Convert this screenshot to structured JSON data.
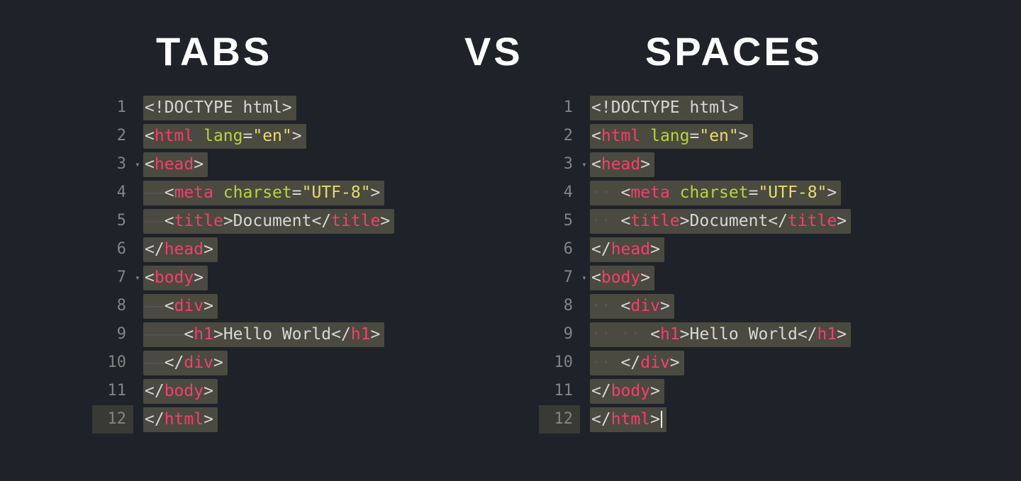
{
  "headings": {
    "tabs": "TABS",
    "vs": "VS",
    "spaces": "SPACES"
  },
  "tabs_editor": {
    "indent_style": "tabs",
    "lines": [
      {
        "n": "1",
        "fold": "",
        "indent_level": 0,
        "parts": [
          {
            "cls": "p",
            "t": "<"
          },
          {
            "cls": "doctype",
            "t": "!DOCTYPE "
          },
          {
            "cls": "doctype",
            "t": "html"
          },
          {
            "cls": "p",
            "t": ">"
          }
        ]
      },
      {
        "n": "2",
        "fold": "",
        "indent_level": 0,
        "parts": [
          {
            "cls": "p",
            "t": "<"
          },
          {
            "cls": "tg",
            "t": "html"
          },
          {
            "cls": "p",
            "t": " "
          },
          {
            "cls": "at",
            "t": "lang"
          },
          {
            "cls": "eq",
            "t": "="
          },
          {
            "cls": "str",
            "t": "\"en\""
          },
          {
            "cls": "p",
            "t": ">"
          }
        ]
      },
      {
        "n": "3",
        "fold": "▾",
        "indent_level": 0,
        "parts": [
          {
            "cls": "p",
            "t": "<"
          },
          {
            "cls": "tg",
            "t": "head"
          },
          {
            "cls": "p",
            "t": ">"
          }
        ]
      },
      {
        "n": "4",
        "fold": "",
        "indent_level": 1,
        "parts": [
          {
            "cls": "p",
            "t": "<"
          },
          {
            "cls": "tg",
            "t": "meta"
          },
          {
            "cls": "p",
            "t": " "
          },
          {
            "cls": "at",
            "t": "charset"
          },
          {
            "cls": "eq",
            "t": "="
          },
          {
            "cls": "str",
            "t": "\"UTF-8\""
          },
          {
            "cls": "p",
            "t": ">"
          }
        ]
      },
      {
        "n": "5",
        "fold": "",
        "indent_level": 1,
        "parts": [
          {
            "cls": "p",
            "t": "<"
          },
          {
            "cls": "tg",
            "t": "title"
          },
          {
            "cls": "p",
            "t": ">"
          },
          {
            "cls": "txt",
            "t": "Document"
          },
          {
            "cls": "p",
            "t": "</"
          },
          {
            "cls": "tg",
            "t": "title"
          },
          {
            "cls": "p",
            "t": ">"
          }
        ]
      },
      {
        "n": "6",
        "fold": "",
        "indent_level": 0,
        "parts": [
          {
            "cls": "p",
            "t": "</"
          },
          {
            "cls": "tg",
            "t": "head"
          },
          {
            "cls": "p",
            "t": ">"
          }
        ]
      },
      {
        "n": "7",
        "fold": "▾",
        "indent_level": 0,
        "parts": [
          {
            "cls": "p",
            "t": "<"
          },
          {
            "cls": "tg",
            "t": "body"
          },
          {
            "cls": "p",
            "t": ">"
          }
        ]
      },
      {
        "n": "8",
        "fold": "",
        "indent_level": 1,
        "parts": [
          {
            "cls": "p",
            "t": "<"
          },
          {
            "cls": "tg",
            "t": "div"
          },
          {
            "cls": "p",
            "t": ">"
          }
        ]
      },
      {
        "n": "9",
        "fold": "",
        "indent_level": 2,
        "parts": [
          {
            "cls": "p",
            "t": "<"
          },
          {
            "cls": "tg",
            "t": "h1"
          },
          {
            "cls": "p",
            "t": ">"
          },
          {
            "cls": "txt",
            "t": "Hello World"
          },
          {
            "cls": "p",
            "t": "</"
          },
          {
            "cls": "tg",
            "t": "h1"
          },
          {
            "cls": "p",
            "t": ">"
          }
        ]
      },
      {
        "n": "10",
        "fold": "",
        "indent_level": 1,
        "parts": [
          {
            "cls": "p",
            "t": "</"
          },
          {
            "cls": "tg",
            "t": "div"
          },
          {
            "cls": "p",
            "t": ">"
          }
        ]
      },
      {
        "n": "11",
        "fold": "",
        "indent_level": 0,
        "parts": [
          {
            "cls": "p",
            "t": "</"
          },
          {
            "cls": "tg",
            "t": "body"
          },
          {
            "cls": "p",
            "t": ">"
          }
        ]
      },
      {
        "n": "12",
        "fold": "",
        "indent_level": 0,
        "cursor": false,
        "parts": [
          {
            "cls": "p",
            "t": "</"
          },
          {
            "cls": "tg",
            "t": "html"
          },
          {
            "cls": "p",
            "t": ">"
          }
        ]
      }
    ],
    "indent_glyph_per_level": "——"
  },
  "spaces_editor": {
    "indent_style": "spaces",
    "lines": [
      {
        "n": "1",
        "fold": "",
        "indent_level": 0,
        "parts": [
          {
            "cls": "p",
            "t": "<"
          },
          {
            "cls": "doctype",
            "t": "!DOCTYPE "
          },
          {
            "cls": "doctype",
            "t": "html"
          },
          {
            "cls": "p",
            "t": ">"
          }
        ]
      },
      {
        "n": "2",
        "fold": "",
        "indent_level": 0,
        "parts": [
          {
            "cls": "p",
            "t": "<"
          },
          {
            "cls": "tg",
            "t": "html"
          },
          {
            "cls": "p",
            "t": " "
          },
          {
            "cls": "at",
            "t": "lang"
          },
          {
            "cls": "eq",
            "t": "="
          },
          {
            "cls": "str",
            "t": "\"en\""
          },
          {
            "cls": "p",
            "t": ">"
          }
        ]
      },
      {
        "n": "3",
        "fold": "▾",
        "indent_level": 0,
        "parts": [
          {
            "cls": "p",
            "t": "<"
          },
          {
            "cls": "tg",
            "t": "head"
          },
          {
            "cls": "p",
            "t": ">"
          }
        ]
      },
      {
        "n": "4",
        "fold": "",
        "indent_level": 1,
        "parts": [
          {
            "cls": "p",
            "t": "<"
          },
          {
            "cls": "tg",
            "t": "meta"
          },
          {
            "cls": "p",
            "t": " "
          },
          {
            "cls": "at",
            "t": "charset"
          },
          {
            "cls": "eq",
            "t": "="
          },
          {
            "cls": "str",
            "t": "\"UTF-8\""
          },
          {
            "cls": "p",
            "t": ">"
          }
        ]
      },
      {
        "n": "5",
        "fold": "",
        "indent_level": 1,
        "parts": [
          {
            "cls": "p",
            "t": "<"
          },
          {
            "cls": "tg",
            "t": "title"
          },
          {
            "cls": "p",
            "t": ">"
          },
          {
            "cls": "txt",
            "t": "Document"
          },
          {
            "cls": "p",
            "t": "</"
          },
          {
            "cls": "tg",
            "t": "title"
          },
          {
            "cls": "p",
            "t": ">"
          }
        ]
      },
      {
        "n": "6",
        "fold": "",
        "indent_level": 0,
        "parts": [
          {
            "cls": "p",
            "t": "</"
          },
          {
            "cls": "tg",
            "t": "head"
          },
          {
            "cls": "p",
            "t": ">"
          }
        ]
      },
      {
        "n": "7",
        "fold": "▾",
        "indent_level": 0,
        "parts": [
          {
            "cls": "p",
            "t": "<"
          },
          {
            "cls": "tg",
            "t": "body"
          },
          {
            "cls": "p",
            "t": ">"
          }
        ]
      },
      {
        "n": "8",
        "fold": "",
        "indent_level": 1,
        "parts": [
          {
            "cls": "p",
            "t": "<"
          },
          {
            "cls": "tg",
            "t": "div"
          },
          {
            "cls": "p",
            "t": ">"
          }
        ]
      },
      {
        "n": "9",
        "fold": "",
        "indent_level": 2,
        "parts": [
          {
            "cls": "p",
            "t": "<"
          },
          {
            "cls": "tg",
            "t": "h1"
          },
          {
            "cls": "p",
            "t": ">"
          },
          {
            "cls": "txt",
            "t": "Hello World"
          },
          {
            "cls": "p",
            "t": "</"
          },
          {
            "cls": "tg",
            "t": "h1"
          },
          {
            "cls": "p",
            "t": ">"
          }
        ]
      },
      {
        "n": "10",
        "fold": "",
        "indent_level": 1,
        "parts": [
          {
            "cls": "p",
            "t": "</"
          },
          {
            "cls": "tg",
            "t": "div"
          },
          {
            "cls": "p",
            "t": ">"
          }
        ]
      },
      {
        "n": "11",
        "fold": "",
        "indent_level": 0,
        "parts": [
          {
            "cls": "p",
            "t": "</"
          },
          {
            "cls": "tg",
            "t": "body"
          },
          {
            "cls": "p",
            "t": ">"
          }
        ]
      },
      {
        "n": "12",
        "fold": "",
        "indent_level": 0,
        "cursor": true,
        "parts": [
          {
            "cls": "p",
            "t": "</"
          },
          {
            "cls": "tg",
            "t": "html"
          },
          {
            "cls": "p",
            "t": ">"
          }
        ]
      }
    ],
    "indent_glyph_per_level": "·· "
  }
}
